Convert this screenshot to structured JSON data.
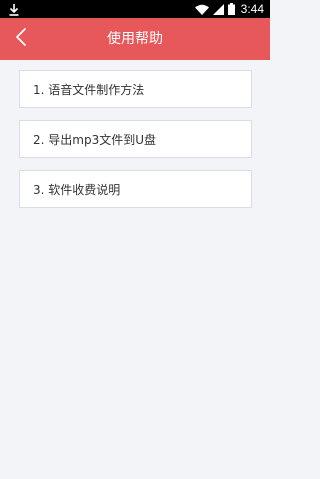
{
  "status_bar": {
    "time": "3:44",
    "icons": [
      "download-icon",
      "wifi-icon",
      "signal-icon",
      "battery-icon"
    ]
  },
  "header": {
    "title": "使用帮助",
    "back_icon": "chevron-left-icon",
    "background": "#e7585b"
  },
  "help": {
    "items": [
      {
        "label": "1. 语音文件制作方法"
      },
      {
        "label": "2. 导出mp3文件到U盘"
      },
      {
        "label": "3. 软件收费说明"
      }
    ]
  }
}
